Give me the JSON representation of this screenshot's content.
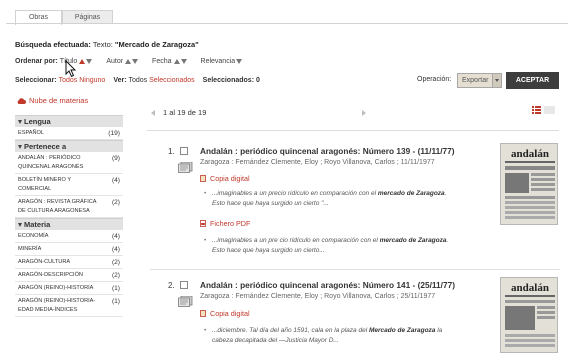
{
  "tabs": [
    {
      "label": "Obras",
      "active": true
    },
    {
      "label": "Páginas",
      "active": false
    }
  ],
  "search": {
    "label": "Búsqueda efectuada:",
    "text_label": "Texto:",
    "query": "\"Mercado de Zaragoza\""
  },
  "sort": {
    "label": "Ordenar por:",
    "options": [
      "Título",
      "Autor",
      "Fecha",
      "Relevancia"
    ]
  },
  "selection": {
    "select_label": "Seleccionar:",
    "all": "Todos",
    "none": "Ninguno",
    "view_label": "Ver:",
    "view_all": "Todos",
    "view_selected": "Seleccionados",
    "selected_label": "Seleccionados:",
    "selected_count": "0"
  },
  "operation": {
    "label": "Operación:",
    "selected": "Exportar",
    "button": "ACEPTAR"
  },
  "cloud_link": "Nube de materias",
  "facets": [
    {
      "header": "Lengua",
      "items": [
        {
          "name": "ESPAÑOL",
          "count": "(19)"
        }
      ]
    },
    {
      "header": "Pertenece a",
      "items": [
        {
          "name": "ANDALÁN : PERIÓDICO QUINCENAL ARAGONÉS",
          "count": "(9)"
        },
        {
          "name": "BOLETÍN MINERO Y COMERCIAL",
          "count": "(4)"
        },
        {
          "name": "ARAGÓN : REVISTA GRÁFICA DE CULTURA ARAGONESA",
          "count": "(2)"
        }
      ]
    },
    {
      "header": "Materia",
      "items": [
        {
          "name": "ECONOMÍA",
          "count": "(4)"
        },
        {
          "name": "MINERÍA",
          "count": "(4)"
        },
        {
          "name": "ARAGÓN-CULTURA",
          "count": "(2)"
        },
        {
          "name": "ARAGÓN-DESCRIPCIÓN",
          "count": "(2)"
        },
        {
          "name": "ARAGÓN (REINO)-HISTORIA",
          "count": "(1)"
        },
        {
          "name": "ARAGÓN (REINO)-HISTORIA-EDAD MEDIA-ÍNDICES",
          "count": "(1)"
        }
      ]
    }
  ],
  "pager": {
    "text": "1 al 19 de 19"
  },
  "results": [
    {
      "number": "1.",
      "title": "Andalán : periódico quincenal aragonés: Número 139 - (11/11/77)",
      "author": "Zaragoza : Fernández Clemente, Eloy ; Royo Villanova, Carlos ; 11/11/1977",
      "links": [
        {
          "label": "Copia digital",
          "snippet_pre": "...imaginables a un precio ridículo en comparación con el ",
          "snippet_bold": "mercado de Zaragoza",
          "snippet_post": ". Esto hace que haya surgido un cierto \"..."
        },
        {
          "label": "Fichero PDF",
          "snippet_pre": "...imaginables a un pre cio ridículo en comparación con el ",
          "snippet_bold": "mercado de Zaragoza",
          "snippet_post": ". Esto hace que haya surgido un cierto..."
        }
      ],
      "thumb_title": "andalán"
    },
    {
      "number": "2.",
      "title": "Andalán : periódico quincenal aragonés: Número 141 - (25/11/77)",
      "author": "Zaragoza : Fernández Clemente, Eloy ; Royo Villanova, Carlos ; 25/11/1977",
      "links": [
        {
          "label": "Copia digital",
          "snippet_pre": "...diciembre. Tal día del año 1591, cala en la plaza del ",
          "snippet_bold": "Mercado de Zaragoza",
          "snippet_post": " la cabeza decapitada del —Justicia Mayor D..."
        }
      ],
      "thumb_title": "andalán"
    }
  ],
  "colors": {
    "accent": "#c0392b",
    "button_bg": "#3d3d3d",
    "facet_header_bg": "#e2e2e2"
  }
}
